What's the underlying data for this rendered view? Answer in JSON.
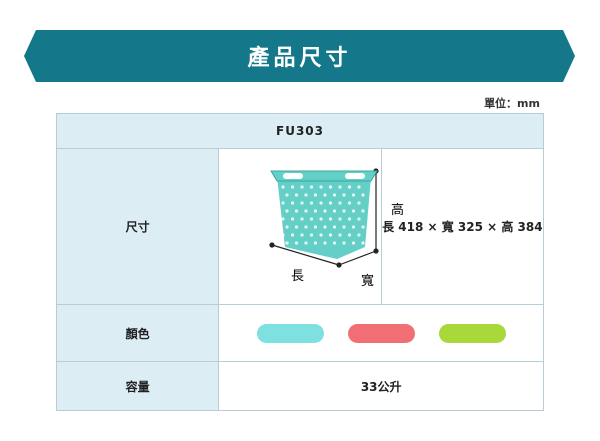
{
  "banner": {
    "title": "產品尺寸",
    "color": "#14788a"
  },
  "unit": "單位：mm",
  "table": {
    "model": "FU303",
    "rows": {
      "size": {
        "label": "尺寸",
        "diagram_labels": {
          "height": "高",
          "length": "長",
          "width": "寬"
        },
        "dimensions": "長 418 × 寬 325 × 高 384"
      },
      "color": {
        "label": "顏色",
        "swatches": [
          "#7fe0e0",
          "#f16f74",
          "#a8d83a"
        ]
      },
      "capacity": {
        "label": "容量",
        "value": "33公升"
      }
    }
  },
  "basket_color": "#63cfc6"
}
